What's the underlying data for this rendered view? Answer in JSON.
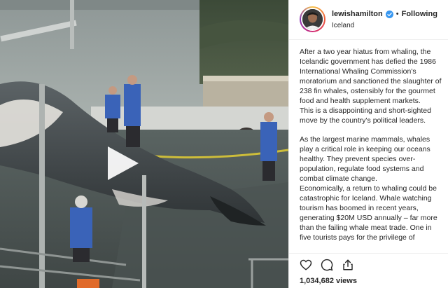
{
  "post": {
    "username": "lewishamilton",
    "follow_state": "Following",
    "dot": "•",
    "location": "Iceland",
    "caption_paragraphs": [
      "After a two year hiatus from whaling, the Icelandic government has defied the 1986 International Whaling Commission's moratorium and sanctioned the slaughter of 238 fin whales, ostensibly for the gourmet food and health supplement markets.",
      "This is a disappointing and short-sighted move by the country's political leaders.",
      "As the largest marine mammals, whales play a critical role in keeping our oceans healthy. They prevent species over-population, regulate food systems and combat climate change.",
      "Economically, a return to whaling could be catastrophic for Iceland. Whale watching tourism has boomed in recent years, generating $20M USD annually – far more than the failing whale meat trade. One in five tourists pays for the privilege of"
    ],
    "views": "1,034,682 views"
  },
  "icons": {
    "verified": "verified-badge-icon",
    "play": "play-icon",
    "like": "heart-icon",
    "comment": "comment-icon",
    "share": "share-icon"
  },
  "colors": {
    "verified_blue": "#3897f0",
    "text": "#262626",
    "border": "#efefef"
  }
}
